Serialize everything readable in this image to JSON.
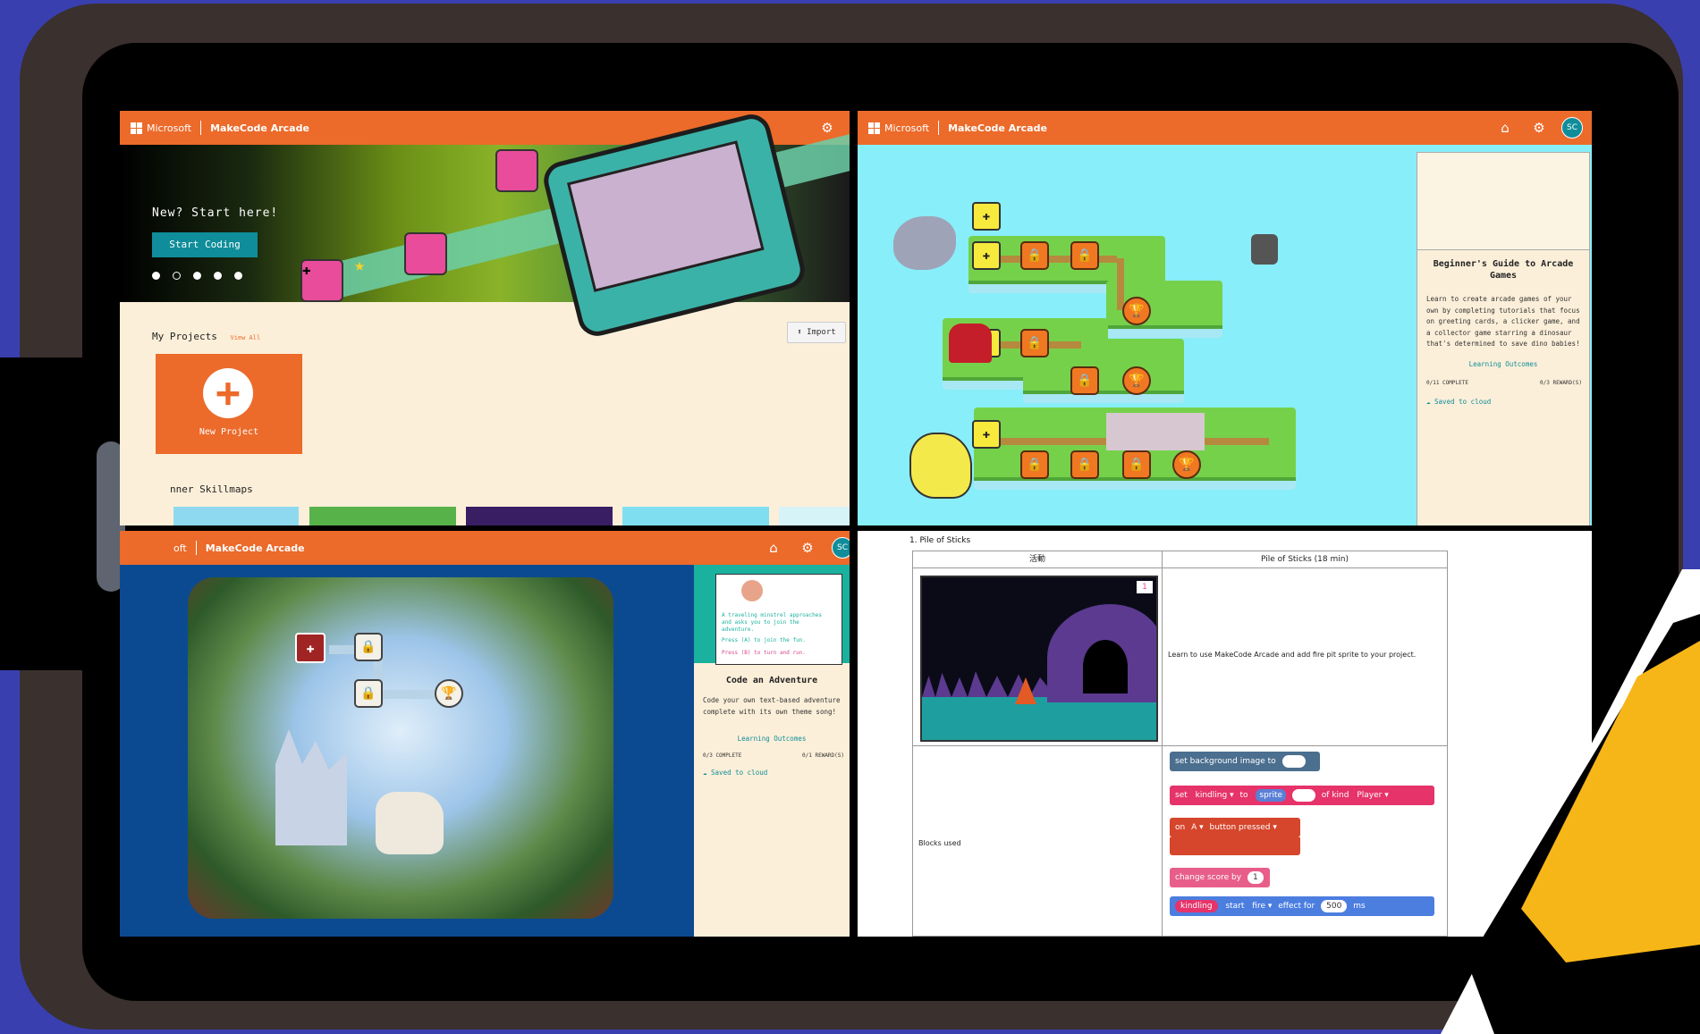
{
  "brand": {
    "microsoft": "Microsoft",
    "app": "MakeCode Arcade",
    "short_prefix": "oft"
  },
  "colors": {
    "accent": "#ec6a2a",
    "teal": "#0f8d9a",
    "background": "#3a3fb0"
  },
  "home_panel": {
    "hero_text": "New? Start here!",
    "start_button": "Start Coding",
    "projects_heading": "My Projects",
    "view_all": "View All",
    "import_button": "Import",
    "new_project_label": "New Project",
    "skillmaps_heading": "nner Skillmaps"
  },
  "skillmap_panel": {
    "user_initials": "SC",
    "card": {
      "title": "Beginner's Guide to Arcade Games",
      "description": "Learn to create arcade games of your own by completing tutorials that focus on greeting cards, a clicker game, and a collector game starring a dinosaur that's determined to save dino babies!",
      "learning_outcomes": "Learning Outcomes",
      "complete": "0/11 COMPLETE",
      "rewards": "0/3 REWARD(S)",
      "saved": "Saved to cloud"
    }
  },
  "adventure_panel": {
    "user_initials": "SC",
    "preview_text_1": "A traveling minstrel approaches and asks you to join the adventure.",
    "preview_text_2": "Press (A) to join the fun.",
    "preview_text_3": "Press (B) to turn and run.",
    "card": {
      "title": "Code an Adventure",
      "description": "Code your own text-based adventure complete with its own theme song!",
      "learning_outcomes": "Learning Outcomes",
      "complete": "0/3 COMPLETE",
      "rewards": "0/1 REWARD(S)",
      "saved": "Saved to cloud"
    }
  },
  "worksheet_panel": {
    "heading": "1. Pile of Sticks",
    "col1_header": "活動",
    "col2_header": "Pile of Sticks (18 min)",
    "game_score": "1",
    "instruction": "Learn to use MakeCode Arcade and add fire pit sprite to your project.",
    "blocks_label": "Blocks used",
    "blocks": {
      "b1": "set background image to",
      "b2_set": "set",
      "b2_var": "kindling",
      "b2_to": "to",
      "b2_sprite": "sprite",
      "b2_kind": "of kind",
      "b2_kind_val": "Player",
      "b3_on": "on",
      "b3_btn": "A",
      "b3_rest": "button pressed",
      "b4": "change score by",
      "b4_val": "1",
      "b5_var": "kindling",
      "b5_start": "start",
      "b5_effect": "fire",
      "b5_for": "effect for",
      "b5_ms_val": "500",
      "b5_ms": "ms"
    }
  }
}
